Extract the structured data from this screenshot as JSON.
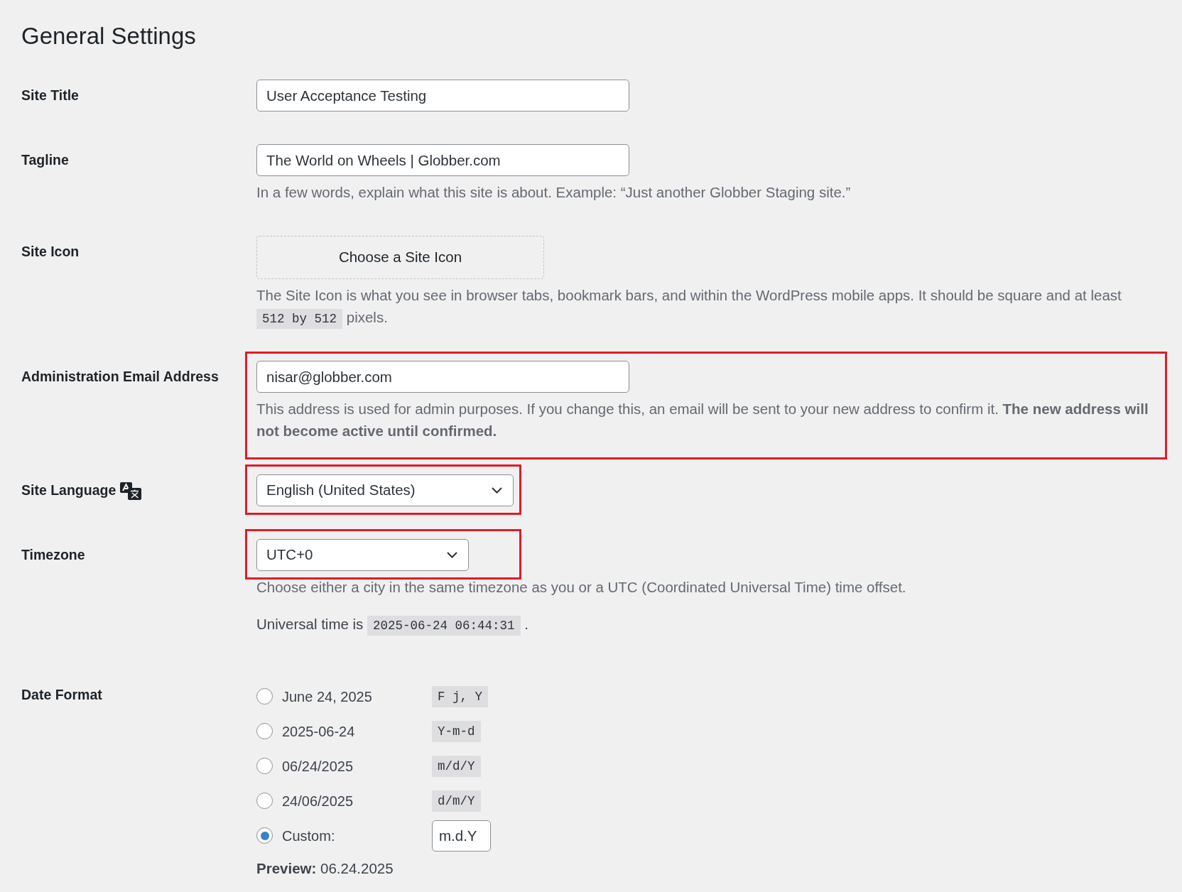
{
  "page_title": "General Settings",
  "fields": [
    {
      "kind": "text",
      "label": "Site Title",
      "value": "User Acceptance Testing",
      "highlighted": false
    },
    {
      "kind": "text",
      "label": "Tagline",
      "value": "The World on Wheels | Globber.com",
      "highlighted": false,
      "description": [
        {
          "kind": "hint",
          "parts": [
            {
              "kind": "text",
              "text": "In a few words, explain what this site is about. Example: “Just another Globber Staging site.”"
            }
          ]
        }
      ]
    },
    {
      "kind": "icon_picker",
      "label": "Site Icon",
      "button": "Choose a Site Icon",
      "highlighted": false,
      "description": [
        {
          "kind": "hint",
          "parts": [
            {
              "kind": "text",
              "text": "The Site Icon is what you see in browser tabs, bookmark bars, and within the WordPress mobile apps. It should be square and at least"
            },
            {
              "kind": "code",
              "text": "512 by 512"
            },
            {
              "kind": "text",
              "text": "pixels."
            }
          ]
        }
      ]
    },
    {
      "kind": "email",
      "label": "Administration Email Address",
      "value": "nisar@globber.com",
      "highlighted": true,
      "description": [
        {
          "kind": "hint",
          "parts": [
            {
              "kind": "text",
              "text": "This address is used for admin purposes. If you change this, an email will be sent to your new address to confirm it. **The new address will not become active until confirmed.**"
            }
          ]
        }
      ]
    },
    {
      "kind": "language_select",
      "label": "Site Language",
      "value": "English (United States)",
      "highlighted": true
    },
    {
      "kind": "select",
      "label": "Timezone",
      "value": "UTC+0",
      "highlighted": true,
      "description": [
        {
          "kind": "hint",
          "parts": [
            {
              "kind": "text",
              "text": "Choose either a city in the same timezone as you or a UTC (Coordinated Universal Time) time offset."
            }
          ]
        },
        {
          "kind": "info",
          "parts": [
            {
              "kind": "text",
              "text": "Universal time is"
            },
            {
              "kind": "code",
              "text": "2025-06-24 06:44:31"
            },
            {
              "kind": "text",
              "text": "."
            }
          ]
        }
      ]
    },
    {
      "kind": "radio_group",
      "label": "Date Format",
      "highlighted": false,
      "options": [
        {
          "kind": "preset",
          "label": "June 24, 2025",
          "format": "F j, Y",
          "selected": false
        },
        {
          "kind": "preset",
          "label": "2025-06-24",
          "format": "Y-m-d",
          "selected": false
        },
        {
          "kind": "preset",
          "label": "06/24/2025",
          "format": "m/d/Y",
          "selected": false
        },
        {
          "kind": "preset",
          "label": "24/06/2025",
          "format": "d/m/Y",
          "selected": false
        },
        {
          "kind": "custom",
          "label": "Custom:",
          "value": "m.d.Y",
          "selected": true
        }
      ],
      "preview": "**Preview:** 06.24.2025"
    }
  ]
}
